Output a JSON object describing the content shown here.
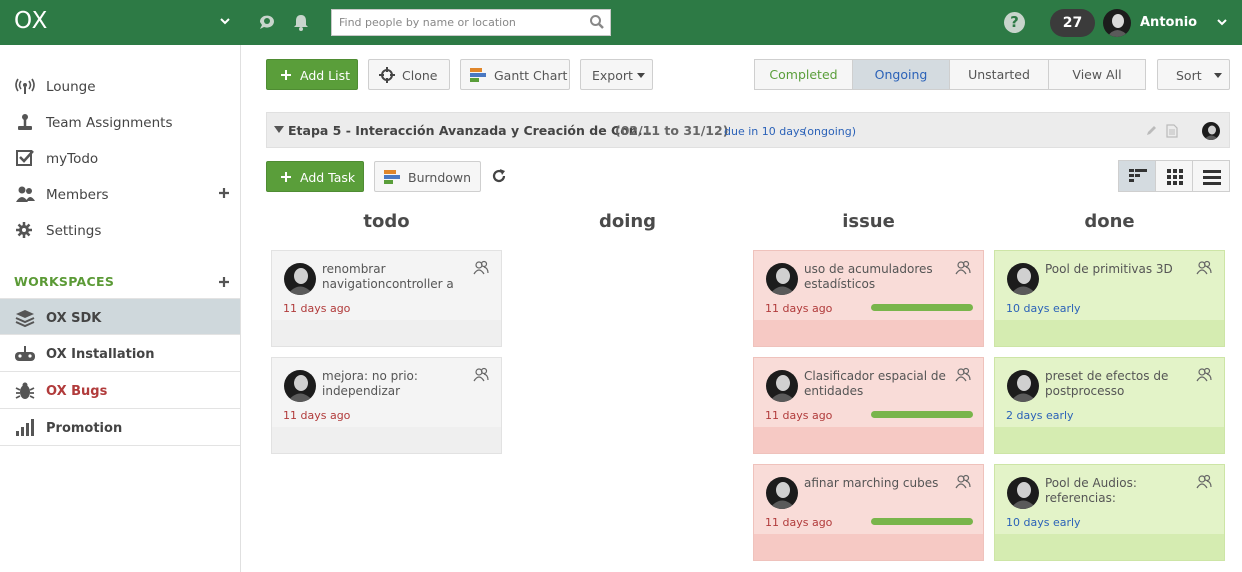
{
  "topbar": {
    "app_name": "OX",
    "search_placeholder": "Find people by name or location",
    "notifications": "27",
    "user_name": "Antonio"
  },
  "sidebar": {
    "nav": [
      {
        "label": "Lounge",
        "icon": "broadcast-icon"
      },
      {
        "label": "Team Assignments",
        "icon": "joystick-icon"
      },
      {
        "label": "myTodo",
        "icon": "checkbox-icon"
      },
      {
        "label": "Members",
        "icon": "users-icon"
      },
      {
        "label": "Settings",
        "icon": "gear-icon"
      }
    ],
    "workspaces_heading": "WORKSPACES",
    "workspaces": [
      {
        "label": "OX SDK",
        "icon": "layers-icon",
        "active": true
      },
      {
        "label": "OX Installation",
        "icon": "gamepad-icon"
      },
      {
        "label": "OX Bugs",
        "icon": "bug-icon"
      },
      {
        "label": "Promotion",
        "icon": "bar-chart-icon"
      }
    ]
  },
  "toolbar": {
    "add_list": "Add List",
    "clone": "Clone",
    "gantt": "Gantt Chart",
    "export": "Export",
    "filters": [
      "Completed",
      "Ongoing",
      "Unstarted",
      "View All"
    ],
    "active_filter": "Ongoing",
    "sort": "Sort"
  },
  "list": {
    "name": "Etapa 5 - Interacción Avanzada y Creación de Con...",
    "dates": "(02/11 to 31/12)",
    "due": "due in 10 days",
    "status": "(ongoing)",
    "add_task": "Add Task",
    "burndown": "Burndown"
  },
  "columns": [
    {
      "title": "todo",
      "cards": [
        {
          "title": "renombrar navigationcontroller a",
          "age": "11 days ago"
        },
        {
          "title": "mejora: no prio: independizar",
          "age": "11 days ago"
        }
      ]
    },
    {
      "title": "doing",
      "cards": []
    },
    {
      "title": "issue",
      "cards": [
        {
          "title": "uso de acumuladores estadísticos",
          "age": "11 days ago",
          "progress": 1.0
        },
        {
          "title": "Clasificador espacial de entidades",
          "age": "11 days ago",
          "progress": 1.0
        },
        {
          "title": "afinar marching cubes",
          "age": "11 days ago",
          "progress": 1.0
        }
      ]
    },
    {
      "title": "done",
      "cards": [
        {
          "title": "Pool de primitivas 3D",
          "age": "10 days early"
        },
        {
          "title": "preset de efectos de postprocesso",
          "age": "2 days early"
        },
        {
          "title": "Pool de Audios: referencias:",
          "age": "10 days early"
        }
      ]
    }
  ],
  "colors": {
    "brand": "#2d7a45",
    "accent_green": "#5a9e3a",
    "issue_card": "#f9dcd8",
    "done_card": "#e3f3c8",
    "link_blue": "#2b62b8",
    "overdue_red": "#b13b3b"
  }
}
